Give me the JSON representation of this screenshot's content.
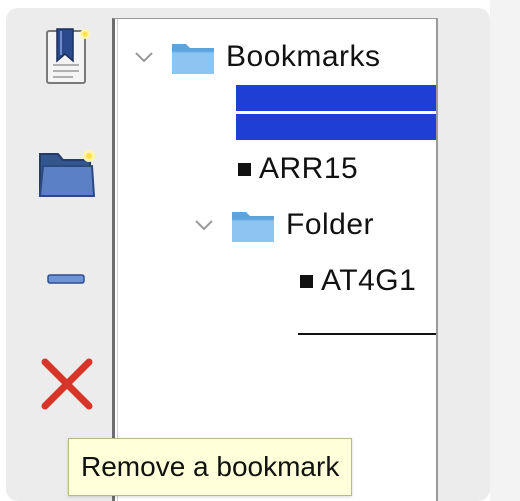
{
  "toolbar": {
    "buttons": [
      {
        "icon": "add-bookmark-icon"
      },
      {
        "icon": "add-folder-icon"
      },
      {
        "icon": "add-separator-icon"
      },
      {
        "icon": "remove-icon"
      }
    ]
  },
  "tree": {
    "root": {
      "label": "Bookmarks",
      "expanded": true
    },
    "items": [
      {
        "type": "bookmark",
        "label": "ARR15"
      },
      {
        "type": "folder",
        "label": "Folder",
        "expanded": true
      },
      {
        "type": "bookmark",
        "label": "AT4G1"
      }
    ]
  },
  "tooltip": {
    "text": "Remove a bookmark"
  },
  "colors": {
    "selection": "#1f3fd4",
    "tooltip_bg": "#ffffd9",
    "remove_red": "#d8352a"
  }
}
